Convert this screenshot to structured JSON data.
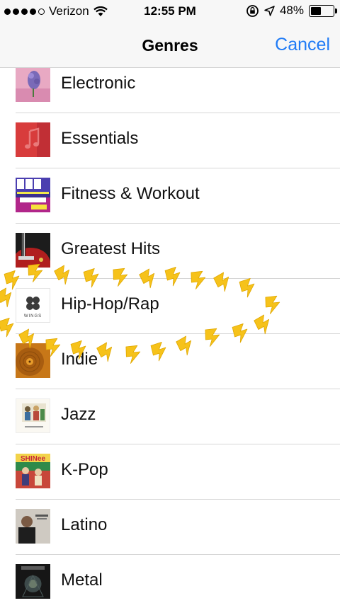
{
  "status_bar": {
    "carrier": "Verizon",
    "time": "12:55 PM",
    "battery": "48%",
    "battery_level": 0.48,
    "signal_bars_filled": 4,
    "signal_bars_total": 5
  },
  "nav": {
    "title": "Genres",
    "cancel_label": "Cancel"
  },
  "genres": [
    {
      "label": "Electronic",
      "art": "purple-flower-art"
    },
    {
      "label": "Essentials",
      "art": "red-music-note-art"
    },
    {
      "label": "Fitness & Workout",
      "art": "now-workout-2016-art"
    },
    {
      "label": "Greatest Hits",
      "art": "red-guitar-art"
    },
    {
      "label": "Hip-Hop/Rap",
      "art": "wings-album-art",
      "art_text": "WINGS"
    },
    {
      "label": "Indie",
      "art": "vinyl-record-art"
    },
    {
      "label": "Jazz",
      "art": "illustrated-figures-art"
    },
    {
      "label": "K-Pop",
      "art": "shinee-album-art",
      "art_text": "SHINee"
    },
    {
      "label": "Latino",
      "art": "portrait-photo-art"
    },
    {
      "label": "Metal",
      "art": "dark-band-art"
    }
  ],
  "annotation": {
    "highlighted_item": "Hip-Hop/Rap",
    "color": "#f6c21a"
  },
  "colors": {
    "accent": "#1f7bf6",
    "bar_background": "#f7f7f7",
    "separator": "#d6d6d6"
  }
}
